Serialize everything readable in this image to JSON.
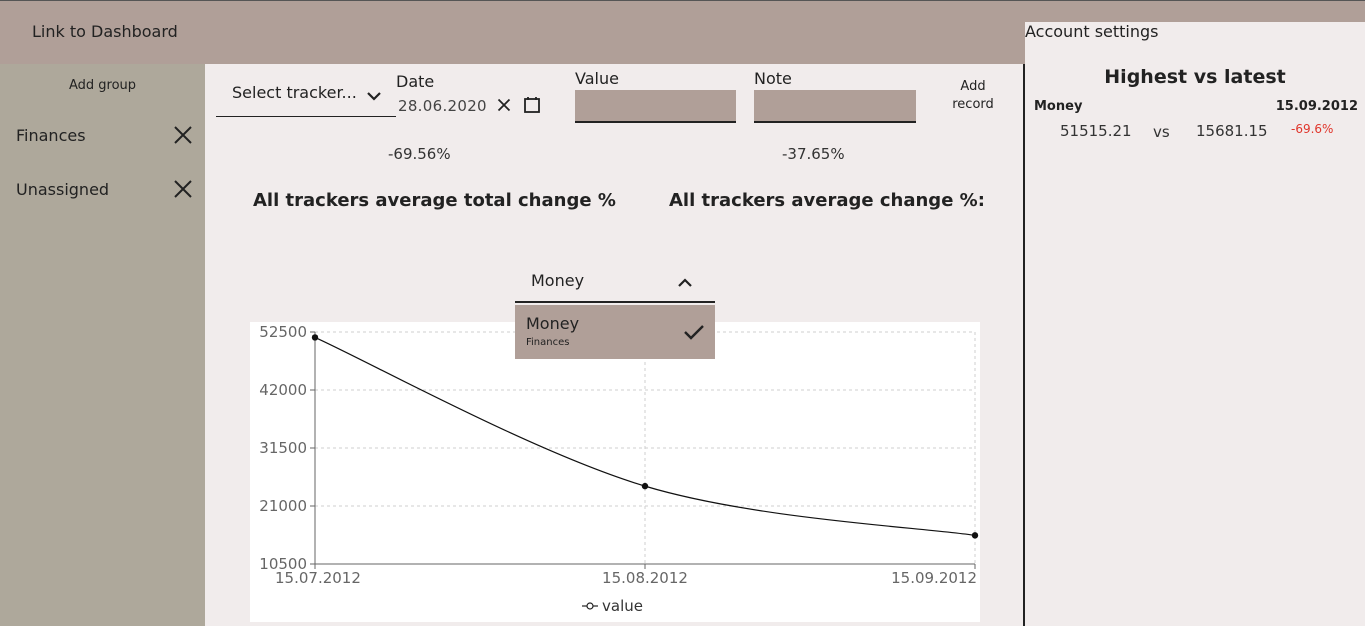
{
  "topbar": {
    "dashboard_link": "Link to Dashboard",
    "account_settings": "Account settings"
  },
  "sidebar": {
    "add_group": "Add group",
    "groups": [
      {
        "label": "Finances"
      },
      {
        "label": "Unassigned"
      }
    ]
  },
  "record_form": {
    "tracker_select": "Select tracker...",
    "date_label": "Date",
    "date_value": "28.06.2020",
    "value_label": "Value",
    "value_input": "",
    "note_label": "Note",
    "note_input": "",
    "add_record": "Add record"
  },
  "stats": {
    "total_change_value": "-69.56%",
    "avg_change_value": "-37.65%",
    "total_change_heading": "All trackers average total change %",
    "avg_change_heading": "All trackers average change %:"
  },
  "tracker_dropdown": {
    "selected": "Money",
    "options": [
      {
        "title": "Money",
        "subtitle": "Finances",
        "checked": true
      }
    ]
  },
  "chart_data": {
    "type": "line",
    "categories": [
      "15.07.2012",
      "15.08.2012",
      "15.09.2012"
    ],
    "series": [
      {
        "name": "value",
        "values": [
          51515.21,
          24600,
          15681.15
        ]
      }
    ],
    "y_ticks": [
      "52500",
      "42000",
      "31500",
      "21000",
      "10500"
    ],
    "ylim": [
      10500,
      52500
    ],
    "grid": true,
    "legend_position": "bottom-center",
    "line_color": "#111111"
  },
  "highest_vs_latest": {
    "title": "Highest vs latest",
    "tracker": "Money",
    "date": "15.09.2012",
    "highest": "51515.21",
    "vs": "vs",
    "latest": "15681.15",
    "change": "-69.6%",
    "change_color": "#e0352b"
  }
}
